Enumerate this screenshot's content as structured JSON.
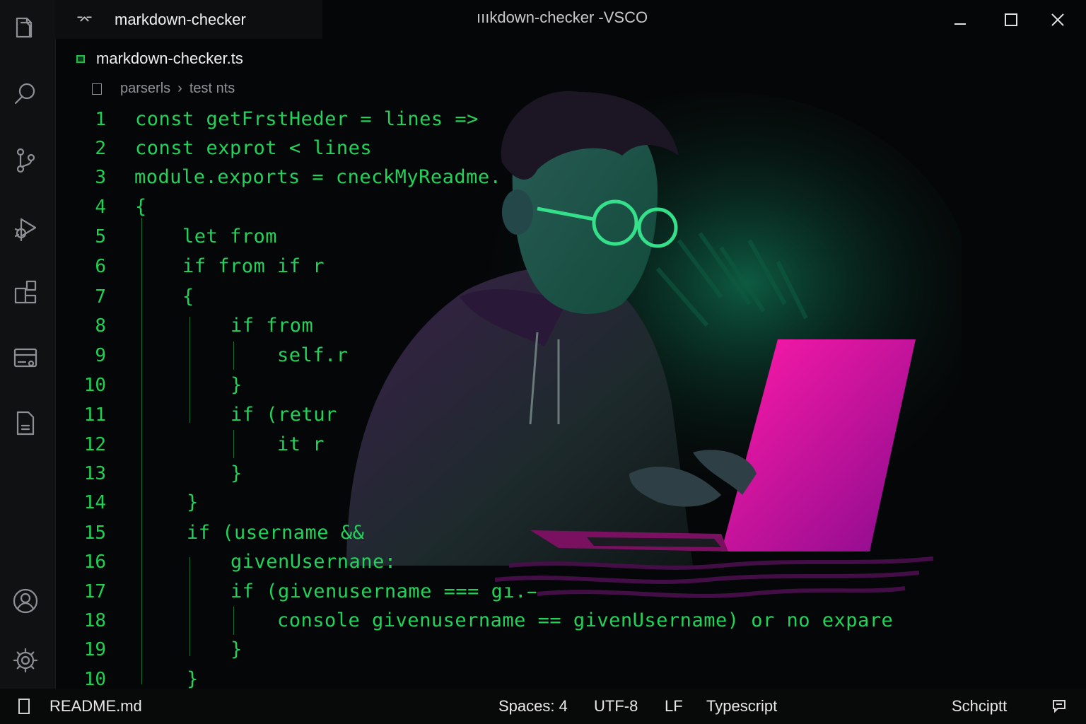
{
  "titlebar": {
    "tab_label": "markdown-checker",
    "window_title": "ıııkdown-checker -VSCO"
  },
  "editor": {
    "file_tab": "markdown-checker.ts",
    "breadcrumb": [
      "parserls",
      "test nts"
    ],
    "lines": [
      {
        "num": "1",
        "text": "const getFrstHeder = lines =>"
      },
      {
        "num": "2",
        "text": "const exprot < lines"
      },
      {
        "num": "3",
        "text": "module.exports = cneckMyReadme."
      },
      {
        "num": "4",
        "text": "{"
      },
      {
        "num": "5",
        "text": "let from"
      },
      {
        "num": "6",
        "text": "if from if r"
      },
      {
        "num": "7",
        "text": "{"
      },
      {
        "num": "8",
        "text": "if from"
      },
      {
        "num": "9",
        "text": "self.r"
      },
      {
        "num": "10",
        "text": "}"
      },
      {
        "num": "11",
        "text": "if (retur"
      },
      {
        "num": "12",
        "text": "it r"
      },
      {
        "num": "13",
        "text": "}"
      },
      {
        "num": "14",
        "text": "}"
      },
      {
        "num": "15",
        "text": "if (username &&"
      },
      {
        "num": "16",
        "text": "givenUsernane:"
      },
      {
        "num": "17",
        "text": "if (givenusername === gı.̵"
      },
      {
        "num": "18",
        "text": "console givenusername == givenUsername) or no expare"
      },
      {
        "num": "19",
        "text": "}"
      },
      {
        "num": "10",
        "text": "}"
      }
    ]
  },
  "activity_bar": [
    {
      "icon": "explorer-icon"
    },
    {
      "icon": "search-icon"
    },
    {
      "icon": "source-control-icon"
    },
    {
      "icon": "run-debug-icon"
    },
    {
      "icon": "extensions-icon"
    },
    {
      "icon": "remote-explorer-icon"
    },
    {
      "icon": "document-icon"
    },
    {
      "icon": "account-icon"
    },
    {
      "icon": "settings-gear-icon"
    }
  ],
  "status": {
    "file": "README.md",
    "spaces": "Spaces: 4",
    "encoding": "UTF-8",
    "eol": "LF",
    "language": "Typescript",
    "extra": "Schciptt"
  },
  "colors": {
    "code_green": "#22d25a",
    "laptop_pink": "#e0088f",
    "background": "#050607"
  }
}
